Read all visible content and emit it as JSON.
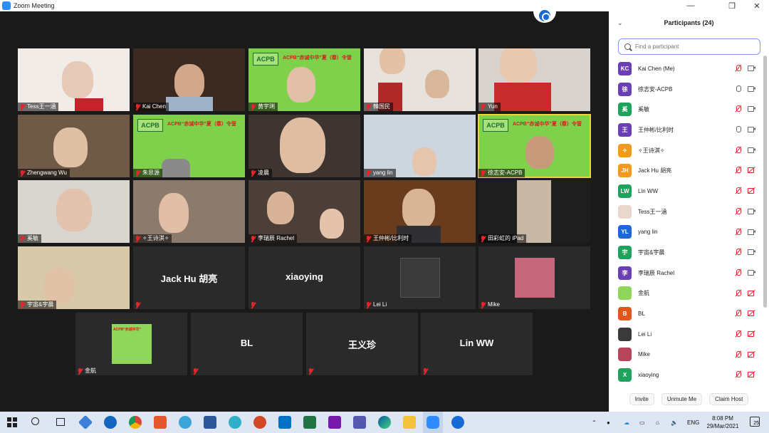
{
  "window": {
    "title": "Zoom Meeting",
    "minimize_icon": "minimize-icon",
    "restore_icon": "restore-icon",
    "close_icon": "close-icon"
  },
  "gallery": {
    "tiles": [
      {
        "name": "Tess王一涵"
      },
      {
        "name": "Kai Chen"
      },
      {
        "name": "黄宇琍",
        "banner": "ACPB“赤诚中华”夏（春）令营",
        "logo": "ACPB"
      },
      {
        "name": "韓国民"
      },
      {
        "name": "Yun"
      },
      {
        "name": "Zhengwang Wu"
      },
      {
        "name": "朱思源",
        "banner": "ACPB“赤诚中华”夏（春）令营",
        "logo": "ACPB"
      },
      {
        "name": "凌晨"
      },
      {
        "name": "yang lin"
      },
      {
        "name": "徐志安-ACPB",
        "banner": "ACPB“赤诚中华”夏（春）令营",
        "logo": "ACPB"
      },
      {
        "name": "奚敏"
      },
      {
        "name": "✧王诗淇✧"
      },
      {
        "name": "李瑞辰 Rachel"
      },
      {
        "name": "王仲彬/比利时"
      },
      {
        "name": "田彩虹的 iPad"
      },
      {
        "name": "宇宙&宇晨"
      },
      {
        "name": "",
        "center": "Jack Hu 胡亮"
      },
      {
        "name": "",
        "center": "xiaoying"
      },
      {
        "name": "Lei Li"
      },
      {
        "name": "Mike"
      },
      {
        "name": "金航",
        "banner": "ACPB“赤诚中华”"
      },
      {
        "name": "",
        "center": "BL"
      },
      {
        "name": "",
        "center": "王义珍"
      },
      {
        "name": "",
        "center": "Lin WW"
      }
    ]
  },
  "participants": {
    "title": "Participants (24)",
    "search_placeholder": "Find a participant",
    "list": [
      {
        "initials": "KC",
        "name": "Kai Chen (Me)",
        "color": "#6a3fb5",
        "mic": "muted",
        "cam": "on"
      },
      {
        "initials": "徐",
        "name": "徐志安-ACPB",
        "color": "#6a3fb5",
        "mic": "on",
        "cam": "on"
      },
      {
        "initials": "奚",
        "name": "奚敏",
        "color": "#1fa35c",
        "mic": "muted",
        "cam": "on"
      },
      {
        "initials": "王",
        "name": "王仲彬/比利时",
        "color": "#6a3fb5",
        "mic": "on",
        "cam": "on"
      },
      {
        "initials": "✧",
        "name": "✧王诗淇✧",
        "color": "#f29a1e",
        "mic": "muted",
        "cam": "on"
      },
      {
        "initials": "JH",
        "name": "Jack Hu 胡亮",
        "color": "#f29a1e",
        "mic": "muted",
        "cam": "off"
      },
      {
        "initials": "LW",
        "name": "Lin WW",
        "color": "#1fa35c",
        "mic": "muted",
        "cam": "off"
      },
      {
        "initials": "",
        "name": "Tess王一涵",
        "color": "#e9d6cc",
        "mic": "muted",
        "cam": "on"
      },
      {
        "initials": "YL",
        "name": "yang lin",
        "color": "#1e66d6",
        "mic": "muted",
        "cam": "on"
      },
      {
        "initials": "宇",
        "name": "宇宙&宇晨",
        "color": "#1fa35c",
        "mic": "muted",
        "cam": "on"
      },
      {
        "initials": "李",
        "name": "李瑞辰 Rachel",
        "color": "#6a3fb5",
        "mic": "muted",
        "cam": "on"
      },
      {
        "initials": "",
        "name": "金航",
        "color": "#8fd65a",
        "mic": "muted",
        "cam": "off"
      },
      {
        "initials": "B",
        "name": "BL",
        "color": "#e0561b",
        "mic": "muted",
        "cam": "off"
      },
      {
        "initials": "",
        "name": "Lei Li",
        "color": "#3a3a3a",
        "mic": "muted",
        "cam": "off"
      },
      {
        "initials": "",
        "name": "Mike",
        "color": "#b7445a",
        "mic": "muted",
        "cam": "off"
      },
      {
        "initials": "X",
        "name": "xiaoying",
        "color": "#1fa35c",
        "mic": "muted",
        "cam": "off"
      }
    ],
    "buttons": {
      "invite": "Invite",
      "unmute_me": "Unmute Me",
      "claim_host": "Claim Host"
    }
  },
  "taskbar": {
    "language": "ENG",
    "time": "8:08 PM",
    "date": "29/Mar/2021",
    "notification_count": "25",
    "apps": [
      "start-icon",
      "search-icon",
      "task-view-icon",
      "app-diamond-icon",
      "edge-legacy-icon",
      "chrome-icon",
      "paint-icon",
      "network-globe-icon",
      "word-icon",
      "edge-drop-icon",
      "powerpoint-icon",
      "outlook-icon",
      "excel-icon",
      "onenote-icon",
      "teams-icon",
      "edge-icon",
      "file-explorer-icon",
      "zoom-icon",
      "tencent-meeting-icon"
    ]
  }
}
